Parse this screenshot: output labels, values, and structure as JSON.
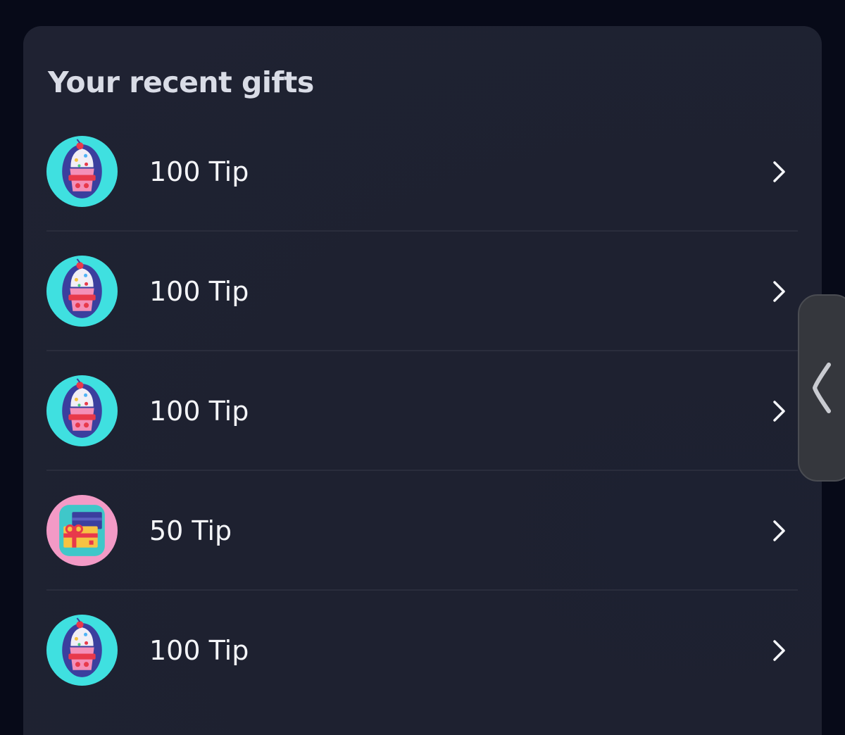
{
  "title": "Your recent gifts",
  "gifts": [
    {
      "label": "100 Tip",
      "icon": "cupcake-icon",
      "badge_color": "#3fe0e0"
    },
    {
      "label": "100 Tip",
      "icon": "cupcake-icon",
      "badge_color": "#3fe0e0"
    },
    {
      "label": "100 Tip",
      "icon": "cupcake-icon",
      "badge_color": "#3fe0e0"
    },
    {
      "label": "50 Tip",
      "icon": "gift-box-icon",
      "badge_color": "#f39ac6"
    },
    {
      "label": "100 Tip",
      "icon": "cupcake-icon",
      "badge_color": "#3fe0e0"
    }
  ],
  "row_action_icon": "chevron-right-icon",
  "side_handle_icon": "chevron-left-icon",
  "colors": {
    "background": "#070a18",
    "card": "#1f2232",
    "text": "#f4f5f8",
    "title": "#d9dce6"
  }
}
